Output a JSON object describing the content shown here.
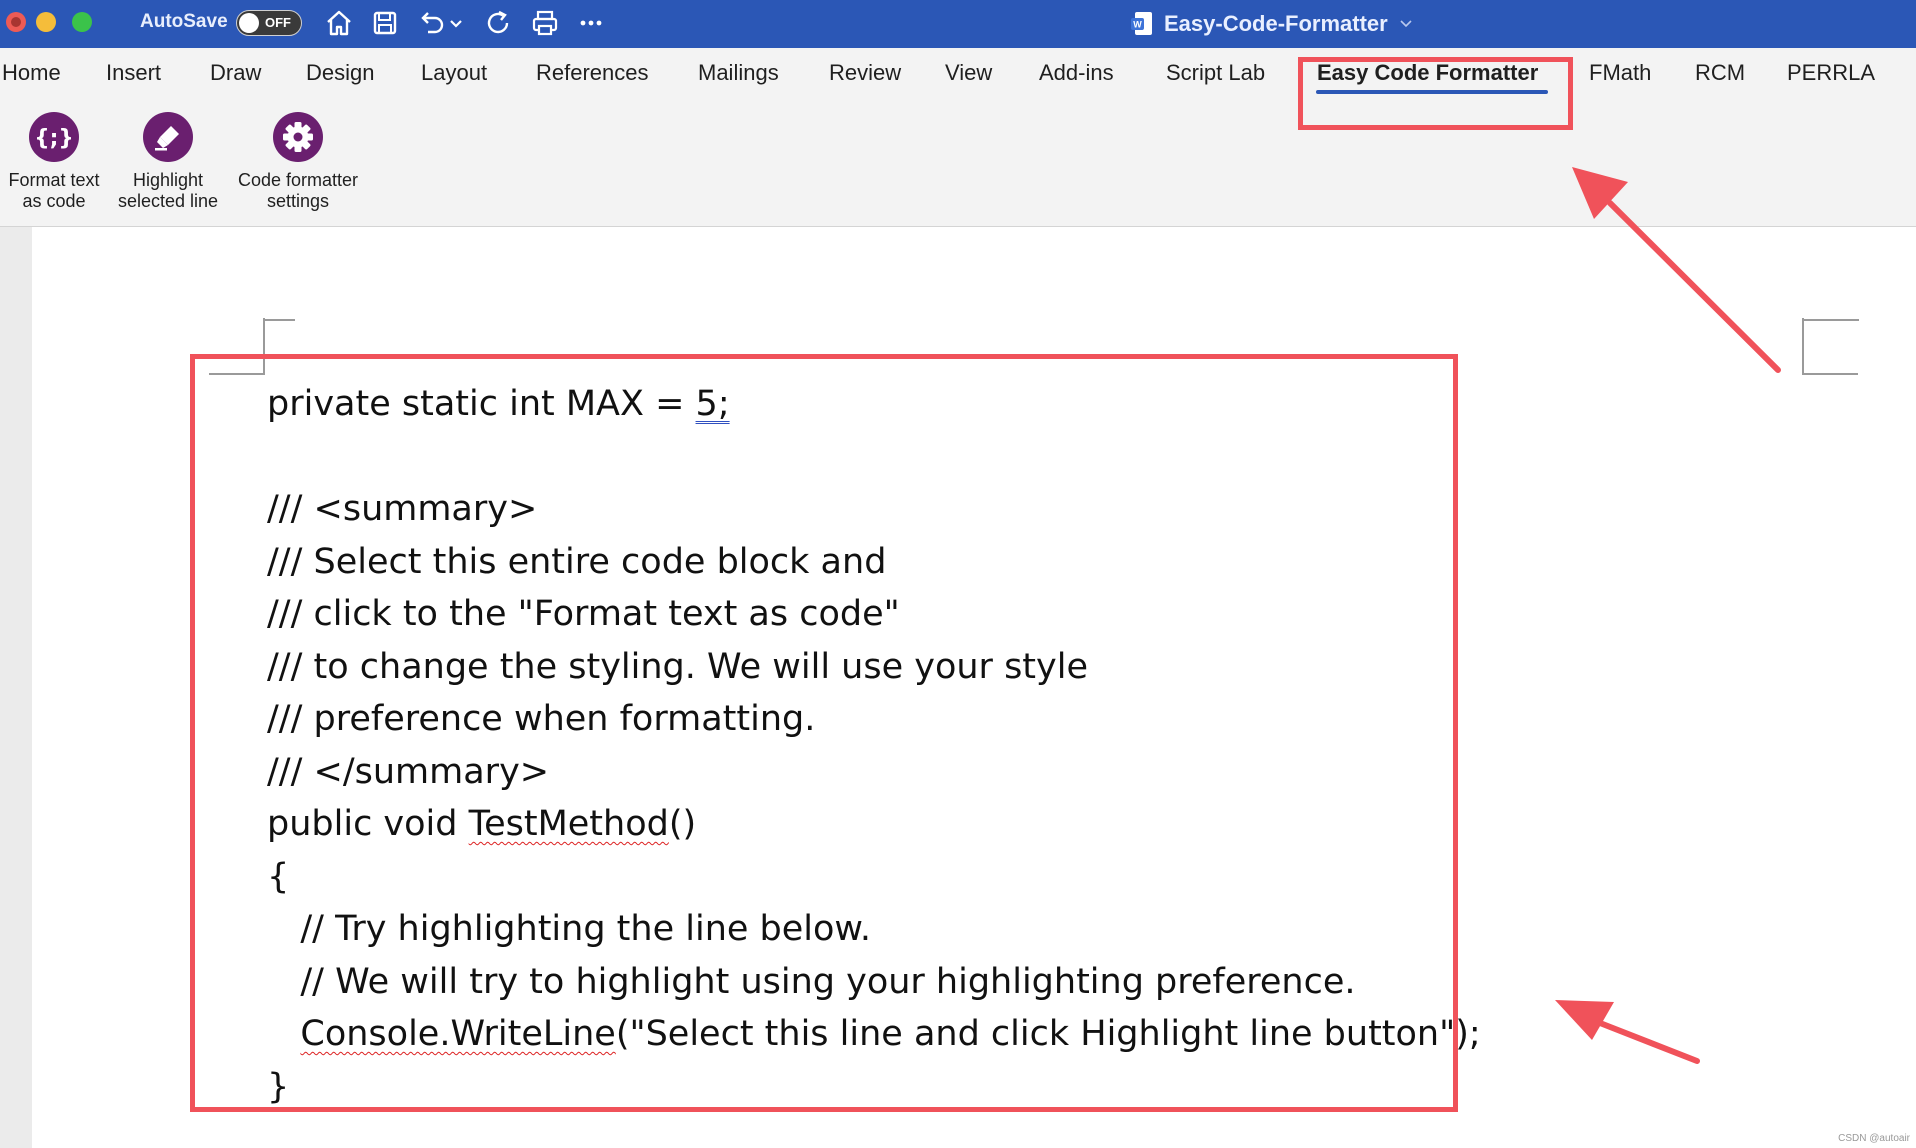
{
  "window": {
    "doc_title": "Easy-Code-Formatter",
    "autosave_label": "AutoSave",
    "autosave_state": "OFF",
    "traffic_colors": [
      "#ee5b55",
      "#f5bd3a",
      "#3bc34a"
    ]
  },
  "tabs": [
    {
      "label": "Home"
    },
    {
      "label": "Insert"
    },
    {
      "label": "Draw"
    },
    {
      "label": "Design"
    },
    {
      "label": "Layout"
    },
    {
      "label": "References"
    },
    {
      "label": "Mailings"
    },
    {
      "label": "Review"
    },
    {
      "label": "View"
    },
    {
      "label": "Add-ins"
    },
    {
      "label": "Script Lab"
    },
    {
      "label": "Easy Code Formatter",
      "active": true
    },
    {
      "label": "FMath"
    },
    {
      "label": "RCM"
    },
    {
      "label": "PERRLA"
    }
  ],
  "ribbon": {
    "format_text": {
      "line1": "Format text",
      "line2": "as code",
      "icon": "curly-braces-icon"
    },
    "highlight": {
      "line1": "Highlight",
      "line2": "selected line",
      "icon": "highlighter-icon"
    },
    "settings": {
      "line1": "Code formatter",
      "line2": "settings",
      "icon": "gear-icon"
    },
    "icon_color": "#6a1f6f"
  },
  "document": {
    "lines": [
      "private static int MAX = 5;",
      "",
      "/// <summary>",
      "/// Select this entire code block and",
      "/// click to the \"Format text as code\"",
      "/// to change the styling. We will use your style",
      "/// preference when formatting.",
      "/// </summary>",
      "public void TestMethod()",
      "{",
      "   // Try highlighting the line below.",
      "   // We will try to highlight using your highlighting preference.",
      "   Console.WriteLine(\"Select this line and click Highlight line button\");",
      "}"
    ]
  },
  "annotation_color": "#f0525a",
  "watermark": "CSDN @autoair"
}
